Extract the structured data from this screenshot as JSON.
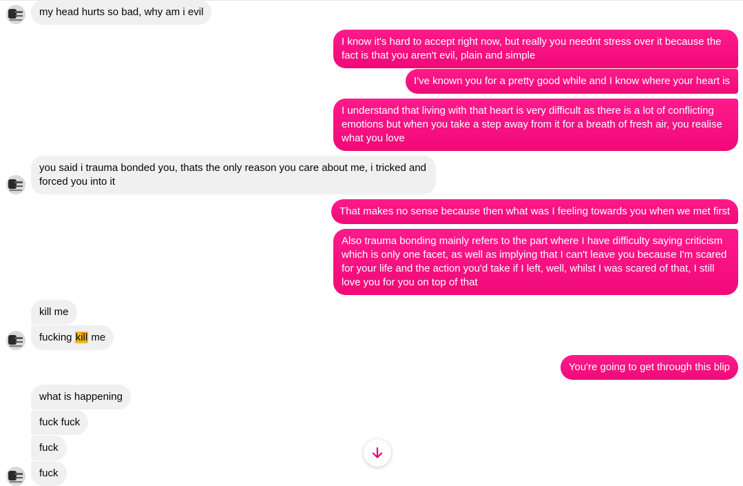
{
  "theme": {
    "outgoing_color": "#ff0a84",
    "incoming_color": "#f0f0f0",
    "highlight_color": "#f5b623",
    "accent_color": "#e6006e"
  },
  "messages": [
    {
      "sender": "them",
      "text": "my head hurts so bad, why am i evil"
    },
    {
      "sender": "me",
      "text": "I know it's hard to accept right now, but really you neednt stress over it because the fact is that you aren't evil, plain and simple"
    },
    {
      "sender": "me",
      "text": "I've known you for a pretty good while and I know where your heart is"
    },
    {
      "sender": "me",
      "text": "I understand that living with that heart is very difficult as there is a lot of conflicting emotions but when you take a step away from it for a breath of fresh air, you realise what you love"
    },
    {
      "sender": "them",
      "text": "you said i trauma bonded you, thats the only reason you care about me, i tricked and forced you into it"
    },
    {
      "sender": "me",
      "text": "That makes no sense because then what was I feeling towards you when we met first"
    },
    {
      "sender": "me",
      "text": "Also trauma bonding mainly refers to the part where I have difficulty saying criticism which is only one facet, as well as implying that I can't leave you because I'm scared for your life and the action you'd take if I left, well, whilst I was scared of that, I still love you for you on top of that"
    },
    {
      "sender": "them",
      "text": "kill me"
    },
    {
      "sender": "them",
      "text_before": "fucking ",
      "text_highlight": "kill",
      "text_after": " me"
    },
    {
      "sender": "me",
      "text": "You're going to get through this blip"
    },
    {
      "sender": "them",
      "text": "what is happening"
    },
    {
      "sender": "them",
      "text": "fuck fuck"
    },
    {
      "sender": "them",
      "text": "fuck"
    },
    {
      "sender": "them",
      "text": "fuck"
    }
  ],
  "icons": {
    "avatar": "contact-avatar",
    "scroll_down": "arrow-down-icon"
  }
}
